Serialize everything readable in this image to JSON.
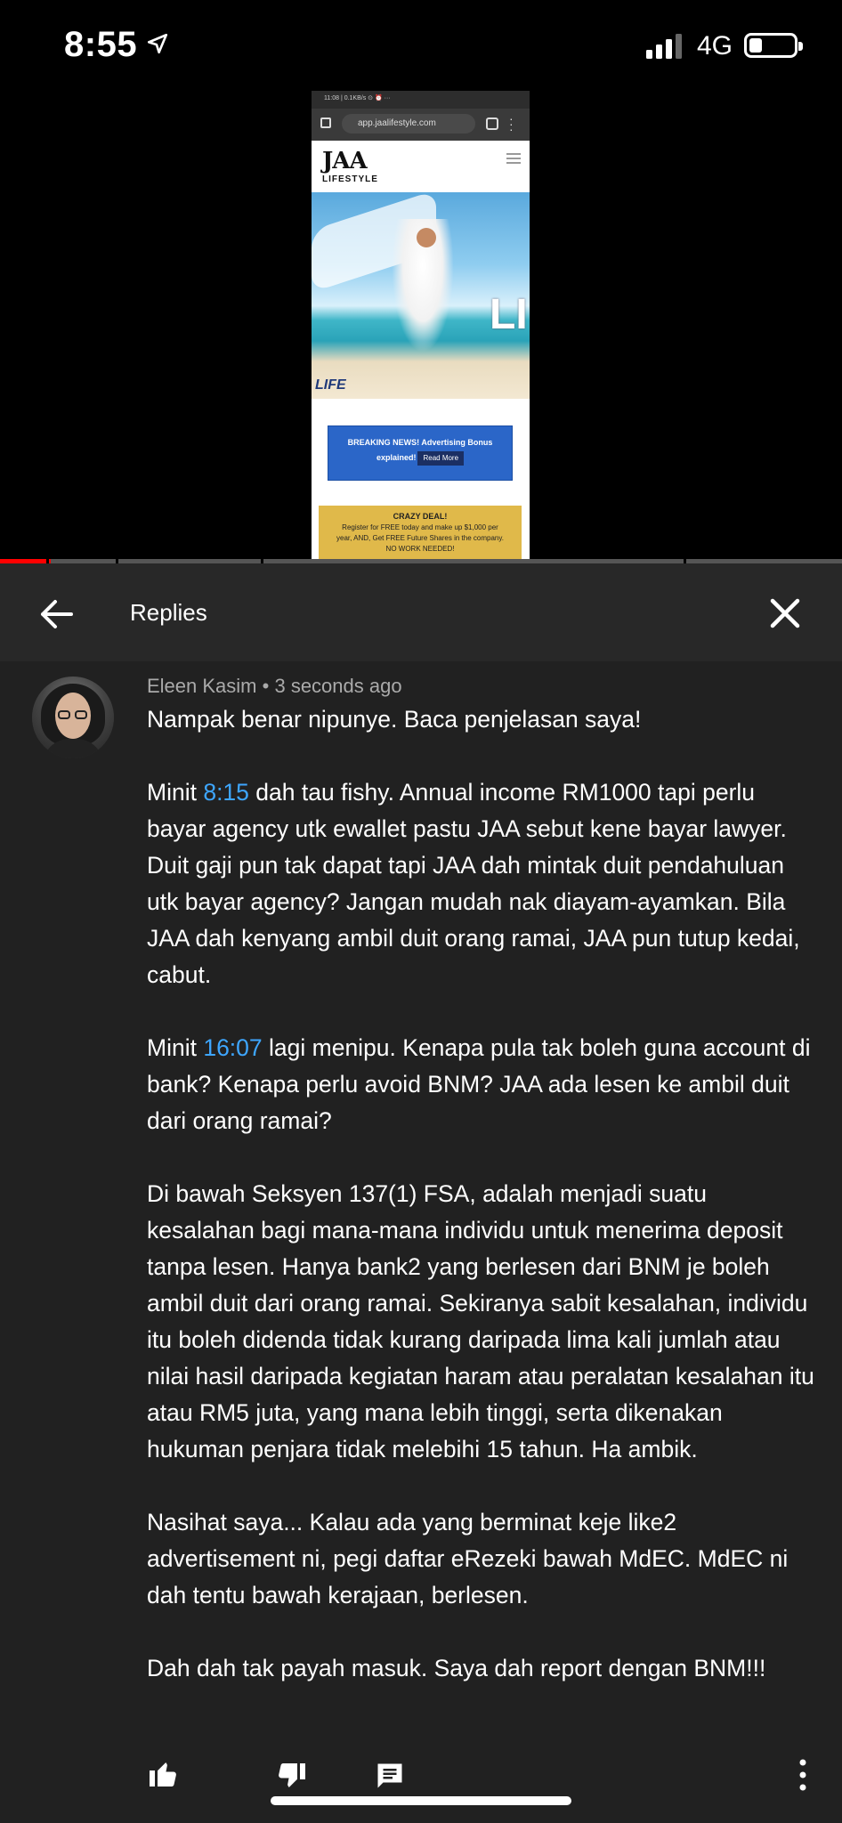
{
  "status_bar": {
    "time": "8:55",
    "network": "4G",
    "icons": [
      "location-arrow-icon",
      "signal-icon",
      "battery-icon"
    ]
  },
  "video": {
    "phone_status": "11:08 | 0.1KB/s ⊙ ⏰ ···",
    "url": "app.jaalifestyle.com",
    "logo": "JAA",
    "logo_sub": "LIFESTYLE",
    "hero_text": "LIFE",
    "hero_side_text": "LI",
    "breaking_news": "BREAKING NEWS! Advertising Bonus",
    "breaking_news_2": "explained!",
    "read_more": "Read More",
    "deal_title": "CRAZY DEAL!",
    "deal_line1": "Register for FREE today and make up $1,000 per",
    "deal_line2": "year, AND, Get FREE Future Shares in the company.",
    "deal_line3": "NO WORK NEEDED!",
    "progress_fraction": 0.06
  },
  "header": {
    "title": "Replies"
  },
  "comment": {
    "author": "Eleen Kasim",
    "separator": "•",
    "time_ago": "3 seconds ago",
    "p1": "Nampak benar nipunye. Baca penjelasan saya!",
    "p2_prefix": "Minit ",
    "p2_ts": "8:15",
    "p2_rest": " dah tau fishy. Annual income RM1000 tapi perlu bayar agency utk ewallet pastu JAA sebut kene bayar lawyer. Duit gaji pun tak dapat tapi JAA dah mintak duit pendahuluan utk bayar agency? Jangan mudah nak diayam-ayamkan. Bila JAA dah kenyang ambil duit orang ramai, JAA pun tutup kedai, cabut.",
    "p3_prefix": "Minit ",
    "p3_ts": "16:07",
    "p3_rest": " lagi menipu. Kenapa pula tak boleh guna account di bank? Kenapa perlu avoid BNM? JAA ada lesen ke ambil duit dari orang ramai?",
    "p4": "Di bawah Seksyen 137(1) FSA, adalah menjadi suatu kesalahan bagi mana-mana individu untuk menerima deposit tanpa lesen. Hanya bank2 yang berlesen dari BNM je boleh ambil duit dari orang ramai. Sekiranya sabit kesalahan, individu itu boleh didenda tidak kurang daripada lima kali jumlah atau nilai hasil daripada kegiatan haram atau peralatan kesalahan itu atau RM5 juta, yang mana lebih tinggi, serta dikenakan hukuman penjara tidak melebihi 15 tahun. Ha ambik.",
    "p5": "Nasihat saya... Kalau ada yang berminat keje like2 advertisement ni, pegi daftar eRezeki bawah MdEC. MdEC ni dah tentu bawah kerajaan, berlesen.",
    "p6": "Dah dah tak payah masuk. Saya dah report dengan BNM!!!"
  },
  "actions": [
    "thumbs-up-icon",
    "thumbs-down-icon",
    "reply-icon",
    "more-vert-icon"
  ],
  "colors": {
    "background": "#212121",
    "header": "#282828",
    "timestamp_link": "#3ea6ff",
    "progress": "#ff0000"
  }
}
